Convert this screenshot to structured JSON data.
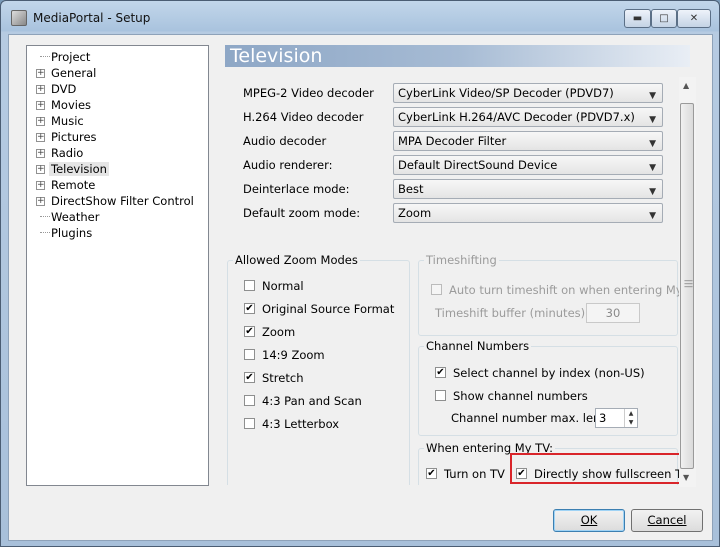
{
  "window": {
    "title": "MediaPortal - Setup"
  },
  "tree": {
    "items": [
      {
        "label": "Project",
        "expandable": false
      },
      {
        "label": "General",
        "expandable": true
      },
      {
        "label": "DVD",
        "expandable": true
      },
      {
        "label": "Movies",
        "expandable": true
      },
      {
        "label": "Music",
        "expandable": true
      },
      {
        "label": "Pictures",
        "expandable": true
      },
      {
        "label": "Radio",
        "expandable": true
      },
      {
        "label": "Television",
        "expandable": true,
        "selected": true
      },
      {
        "label": "Remote",
        "expandable": true
      },
      {
        "label": "DirectShow Filter Control",
        "expandable": true
      },
      {
        "label": "Weather",
        "expandable": false
      },
      {
        "label": "Plugins",
        "expandable": false
      }
    ]
  },
  "section": {
    "title": "Television"
  },
  "decoders": [
    {
      "label": "MPEG-2 Video decoder",
      "value": "CyberLink Video/SP Decoder (PDVD7)"
    },
    {
      "label": "H.264 Video decoder",
      "value": "CyberLink H.264/AVC Decoder (PDVD7.x)"
    },
    {
      "label": "Audio decoder",
      "value": "MPA Decoder Filter"
    },
    {
      "label": "Audio renderer:",
      "value": "Default DirectSound Device"
    },
    {
      "label": "Deinterlace mode:",
      "value": "Best"
    },
    {
      "label": "Default zoom mode:",
      "value": "Zoom"
    }
  ],
  "zoom_modes": {
    "title": "Allowed Zoom Modes",
    "items": [
      {
        "label": "Normal",
        "checked": false
      },
      {
        "label": "Original Source Format",
        "checked": true
      },
      {
        "label": "Zoom",
        "checked": true
      },
      {
        "label": "14:9 Zoom",
        "checked": false
      },
      {
        "label": "Stretch",
        "checked": true
      },
      {
        "label": "4:3 Pan and Scan",
        "checked": false
      },
      {
        "label": "4:3 Letterbox",
        "checked": false
      }
    ]
  },
  "timeshifting": {
    "title": "Timeshifting",
    "auto_label": "Auto turn timeshift on when entering My TV",
    "auto_checked": false,
    "buffer_label": "Timeshift buffer (minutes):",
    "buffer_value": "30"
  },
  "channel_numbers": {
    "title": "Channel Numbers",
    "select_label": "Select channel by index (non-US)",
    "select_checked": true,
    "show_label": "Show channel numbers",
    "show_checked": false,
    "maxlen_label": "Channel number max. length",
    "maxlen_value": "3"
  },
  "entering": {
    "title": "When entering My TV:",
    "turn_on_label": "Turn on TV",
    "turn_on_checked": true,
    "fullscreen_label": "Directly show fullscreen TV",
    "fullscreen_checked": true
  },
  "buttons": {
    "ok": "OK",
    "cancel": "Cancel"
  },
  "colors": {
    "highlight": "#d9252a",
    "header": "#8ea7c6"
  }
}
